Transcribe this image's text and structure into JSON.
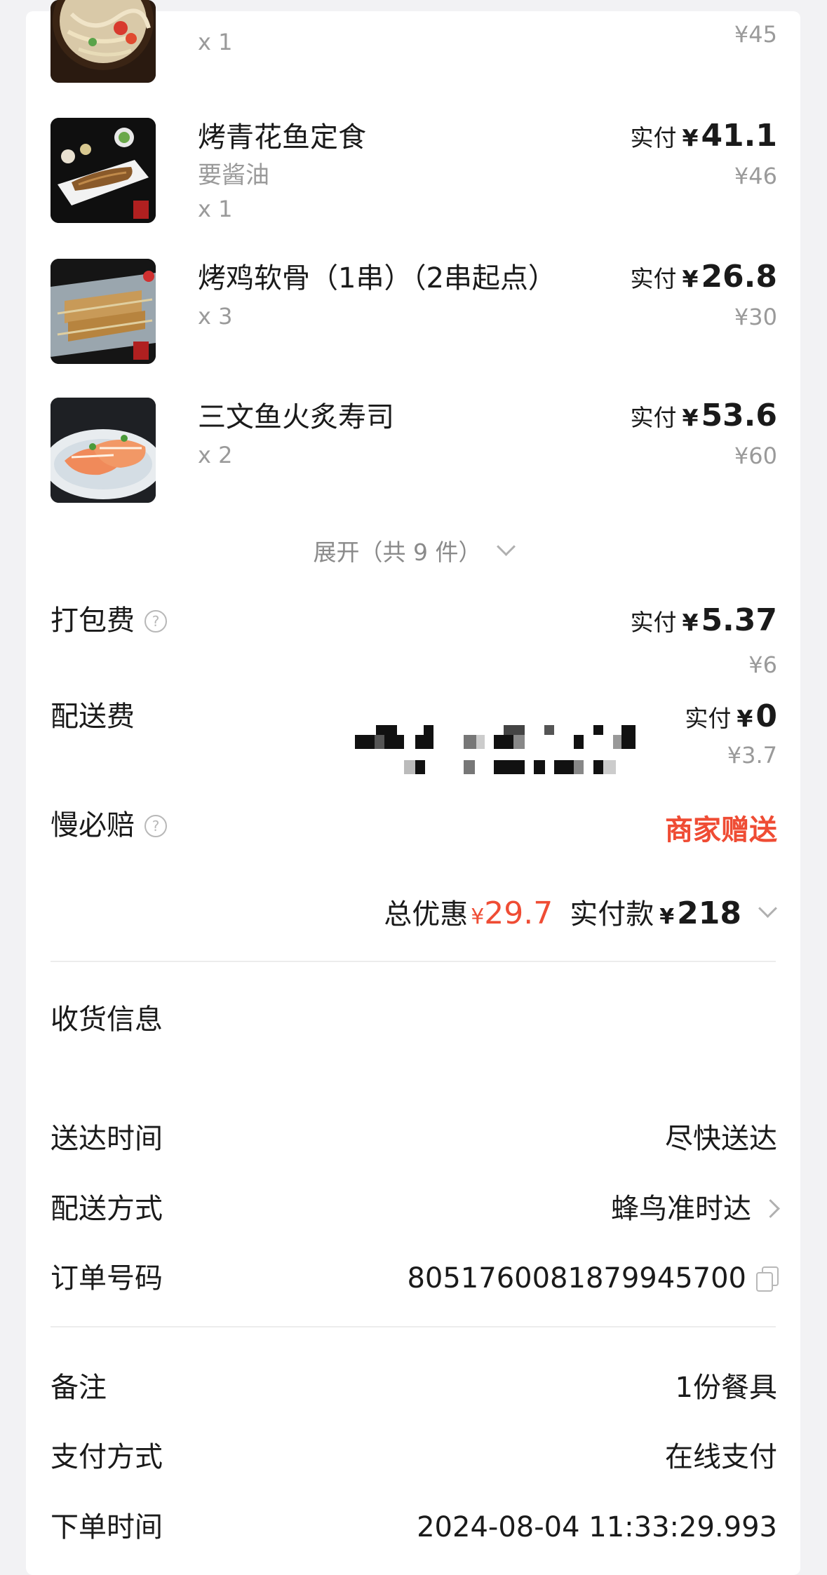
{
  "items": [
    {
      "name": "",
      "note": "",
      "qty": "x 1",
      "paid_prefix": "",
      "paid_yen": "",
      "paid_amount": "",
      "orig_price": "¥45"
    },
    {
      "name": "烤青花鱼定食",
      "note": "要酱油",
      "qty": "x 1",
      "paid_prefix": "实付",
      "paid_yen": "¥",
      "paid_amount": "41.1",
      "orig_price": "¥46"
    },
    {
      "name": "烤鸡软骨（1串）（2串起点）",
      "note": "",
      "qty": "x 3",
      "paid_prefix": "实付",
      "paid_yen": "¥",
      "paid_amount": "26.8",
      "orig_price": "¥30"
    },
    {
      "name": "三文鱼火炙寿司",
      "note": "",
      "qty": "x 2",
      "paid_prefix": "实付",
      "paid_yen": "¥",
      "paid_amount": "53.6",
      "orig_price": "¥60"
    }
  ],
  "expand_label": "展开（共 9 件）",
  "fees": {
    "packing": {
      "label": "打包费",
      "help": "?",
      "paid_prefix": "实付",
      "paid_yen": "¥",
      "paid_amount": "5.37",
      "orig_price": "¥6"
    },
    "delivery": {
      "label": "配送费",
      "paid_prefix": "实付",
      "paid_yen": "¥",
      "paid_amount": "0",
      "orig_price": "¥3.7"
    },
    "late_comp": {
      "label": "慢必赔",
      "help": "?",
      "value": "商家赠送"
    }
  },
  "totals": {
    "discount_label": "总优惠",
    "discount_yen": "¥",
    "discount_value": "29.7",
    "paid_label": "实付款",
    "paid_yen": "¥",
    "paid_value": "218"
  },
  "info": {
    "address_label": "收货信息",
    "delivery_time_label": "送达时间",
    "delivery_time_value": "尽快送达",
    "delivery_method_label": "配送方式",
    "delivery_method_value": "蜂鸟准时达",
    "order_no_label": "订单号码",
    "order_no_value": "8051760081879945700",
    "remark_label": "备注",
    "remark_value": "1份餐具",
    "payment_label": "支付方式",
    "payment_value": "在线支付",
    "order_time_label": "下单时间",
    "order_time_value": "2024-08-04 11:33:29.993"
  },
  "colors": {
    "accent_red": "#ef4c34",
    "text": "#1a1a1a",
    "muted": "#9a9a9a",
    "background": "#f2f2f4"
  },
  "icons": [
    "help-circle-icon",
    "chevron-down-icon",
    "chevron-right-icon",
    "copy-icon"
  ]
}
